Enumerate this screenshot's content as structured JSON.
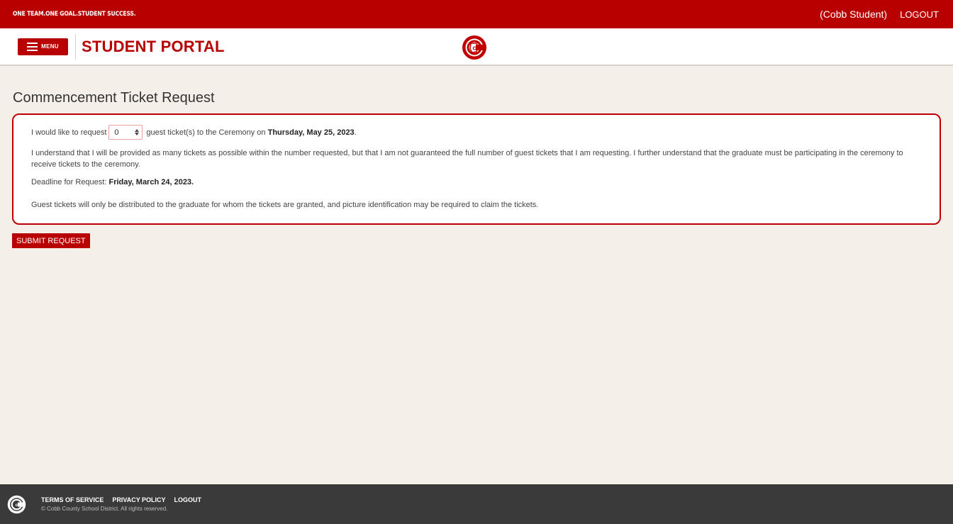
{
  "topbar": {
    "tagline": "ONE TEAM.ONE GOAL.STUDENT SUCCESS.",
    "user": "(Cobb Student)",
    "logout": "LOGOUT"
  },
  "header": {
    "menu_label": "MENU",
    "portal_title": "STUDENT PORTAL",
    "logo_icon": "cobb-c-logo-icon"
  },
  "main": {
    "page_title": "Commencement Ticket Request",
    "request_prefix": "I would like to request",
    "ticket_count": "0",
    "request_suffix": "guest ticket(s) to the Ceremony on",
    "ceremony_date": "Thursday, May 25, 2023",
    "request_end": ".",
    "understand_text": "I understand that I will be provided as many tickets as possible within the number requested, but that I am not guaranteed the full number of guest tickets that I am requesting. I further understand that the graduate must be participating in the ceremony to receive tickets to the ceremony.",
    "deadline_label": "Deadline for Request:",
    "deadline_date": "Friday, March 24, 2023.",
    "guest_text": "Guest tickets will only be distributed to the graduate for whom the tickets are granted, and picture identification may be required to claim the tickets.",
    "submit_label": "SUBMIT REQUEST"
  },
  "footer": {
    "links": [
      "TERMS OF SERVICE",
      "PRIVACY POLICY",
      "LOGOUT"
    ],
    "copyright": "© Cobb County School District. All rights reserved."
  },
  "colors": {
    "brand_red": "#b80000",
    "background": "#f5efe9",
    "footer_bg": "#3a3a3a"
  }
}
